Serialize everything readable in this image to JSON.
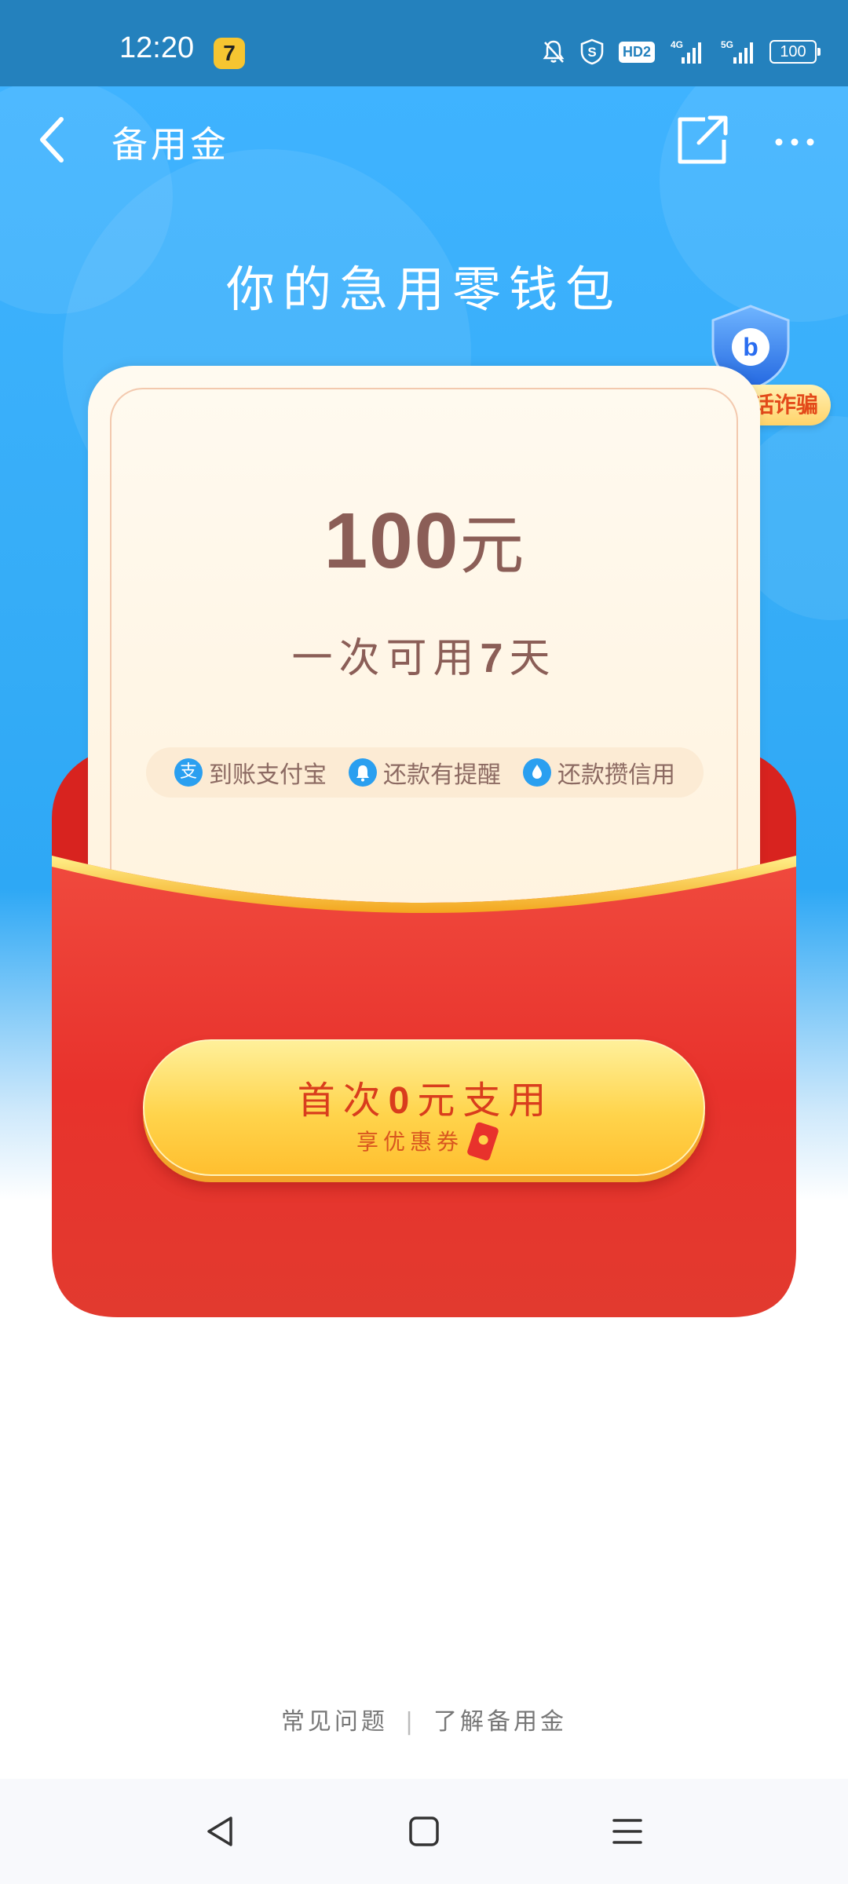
{
  "status_bar": {
    "time": "12:20",
    "app_icon_glyph": "7",
    "hd_label": "HD2",
    "signal_4g_label": "4G",
    "signal_5g_label": "5G",
    "battery": "100"
  },
  "nav": {
    "title": "备用金",
    "back_icon": "chevron-left-icon",
    "share_icon": "share-icon",
    "more_icon": "more-dots-icon"
  },
  "hero": {
    "title": "你的急用零钱包"
  },
  "fraud_badge": {
    "label": "警惕电话诈骗",
    "icon": "shield-b-icon"
  },
  "card": {
    "amount_number": "100",
    "amount_unit": "元",
    "period_prefix": "一次可用",
    "period_number": "7",
    "period_suffix": "天",
    "features": [
      {
        "icon_glyph": "支",
        "label": "到账支付宝"
      },
      {
        "icon_glyph": "🔔",
        "label": "还款有提醒"
      },
      {
        "icon_glyph": "●",
        "label": "还款攒信用"
      }
    ]
  },
  "cta": {
    "main_prefix": "首次",
    "main_number": "0",
    "main_suffix": "元支用",
    "sub_label": "享优惠券"
  },
  "footer": {
    "faq": "常见问题",
    "separator": "|",
    "about": "了解备用金"
  },
  "colors": {
    "hero_blue": "#36adf7",
    "envelope_red": "#e8322c",
    "amount_brown": "#8b5e57",
    "cta_gold": "#ffd44c",
    "cta_text": "#d93d1d"
  }
}
